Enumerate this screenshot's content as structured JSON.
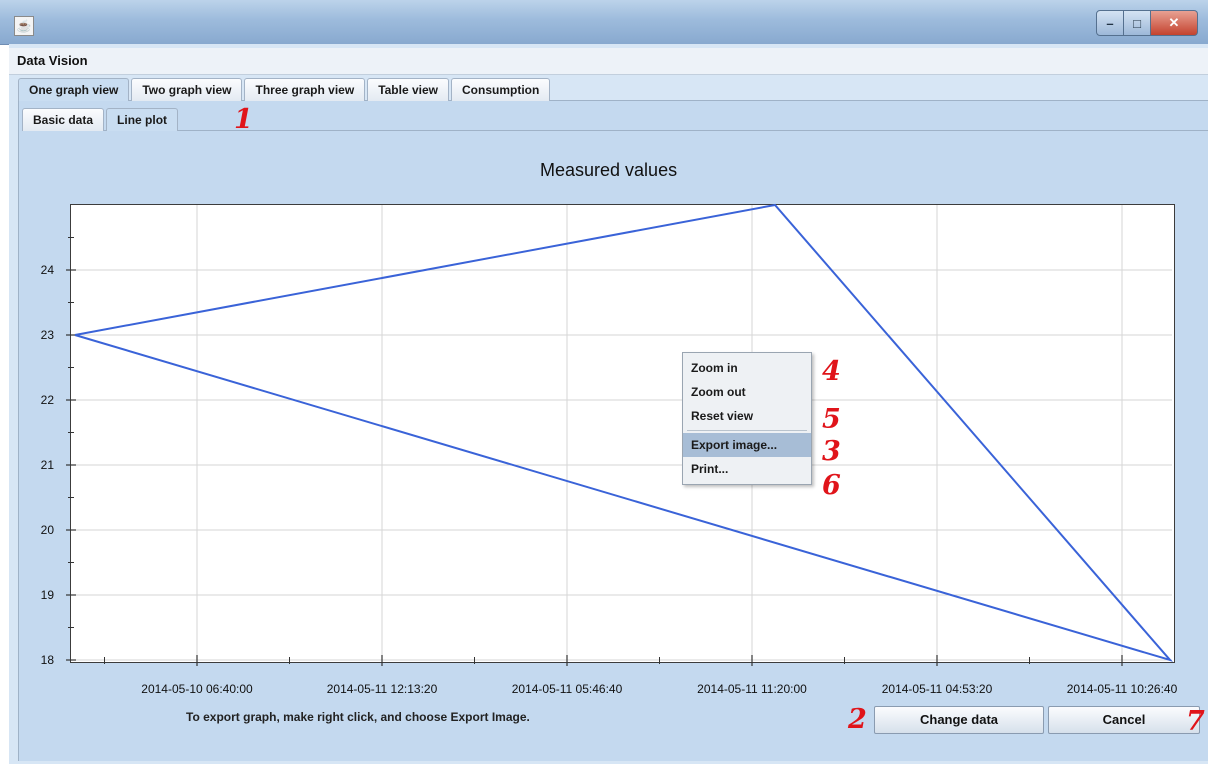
{
  "window": {
    "app_title": "Data Vision"
  },
  "tabs": [
    "One graph view",
    "Two graph view",
    "Three graph view",
    "Table view",
    "Consumption"
  ],
  "subtabs": [
    "Basic data",
    "Line plot"
  ],
  "annotations": {
    "a1": "1",
    "a2": "2",
    "a3": "3",
    "a4": "4",
    "a5": "5",
    "a6": "6",
    "a7": "7"
  },
  "context_menu": [
    "Zoom in",
    "Zoom out",
    "Reset view",
    "Export image...",
    "Print..."
  ],
  "hint": "To export graph, make right click, and choose Export Image.",
  "buttons": {
    "change": "Change data",
    "cancel": "Cancel"
  },
  "chart_data": {
    "type": "line",
    "title": "Measured values",
    "xlabel": "",
    "ylabel": "",
    "x_tick_labels": [
      "2014-05-10 06:40:00",
      "2014-05-11 12:13:20",
      "2014-05-11 05:46:40",
      "2014-05-11 11:20:00",
      "2014-05-11 04:53:20",
      "2014-05-11 10:26:40"
    ],
    "y_ticks": [
      18,
      19,
      20,
      21,
      22,
      23,
      24
    ],
    "ylim": [
      18,
      25
    ],
    "series": [
      {
        "values": [
          23,
          25,
          18,
          23
        ]
      }
    ],
    "grid": true,
    "line_color": "#3a63d8"
  }
}
